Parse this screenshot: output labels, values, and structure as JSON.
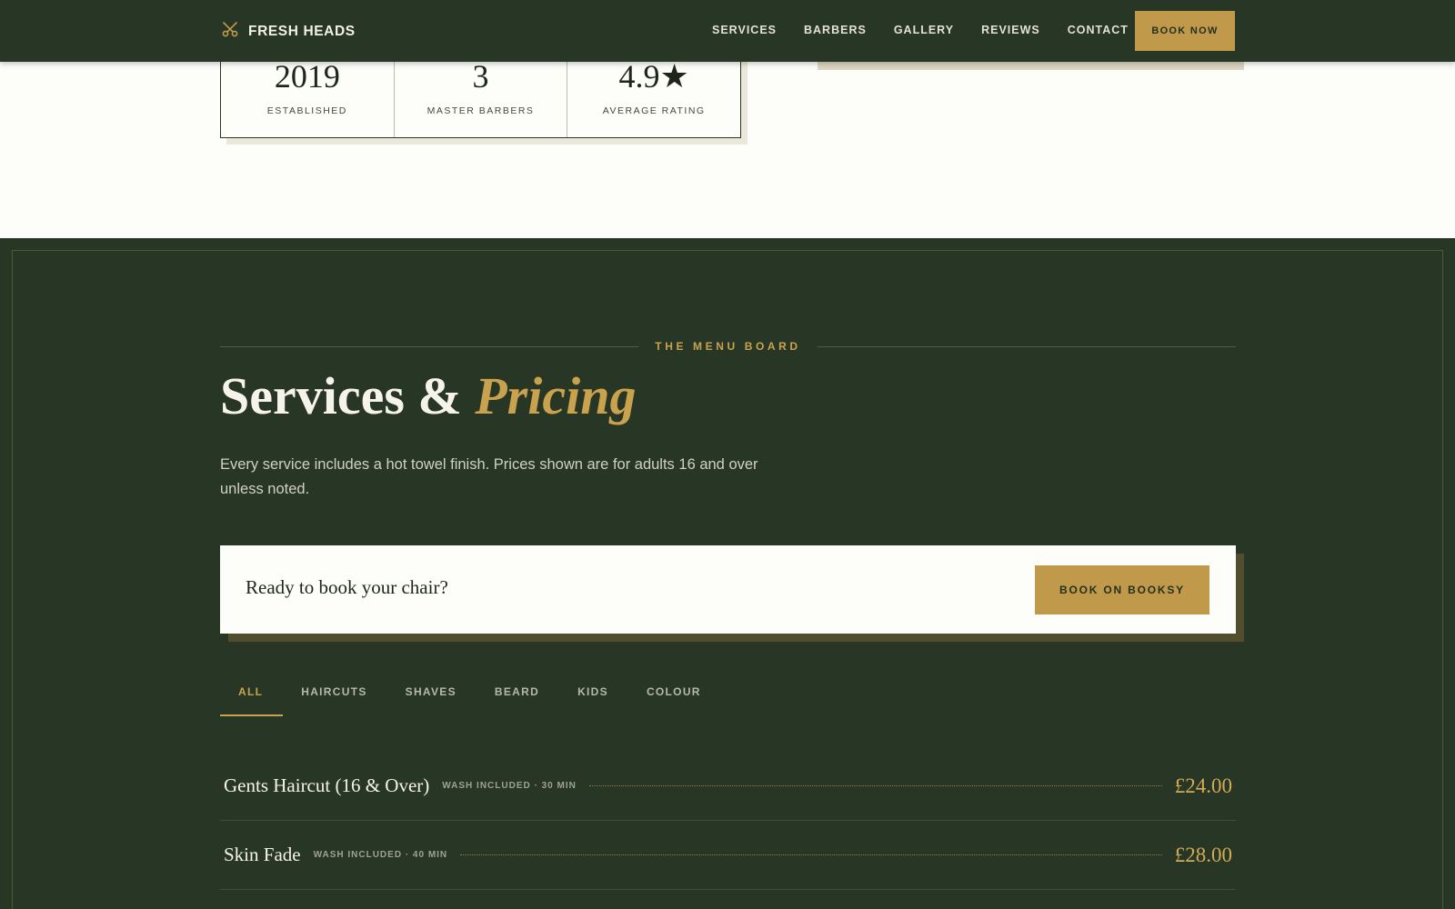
{
  "nav": {
    "brand": "FRESH HEADS",
    "links": [
      "SERVICES",
      "BARBERS",
      "GALLERY",
      "REVIEWS",
      "CONTACT"
    ],
    "book_label": "BOOK NOW"
  },
  "stats": [
    {
      "value": "2019",
      "label": "ESTABLISHED"
    },
    {
      "value": "3",
      "label": "MASTER BARBERS"
    },
    {
      "value": "4.9★",
      "label": "AVERAGE RATING"
    }
  ],
  "services": {
    "eyebrow": "THE MENU BOARD",
    "title_main": "Services & ",
    "title_accent": "Pricing",
    "intro": "Every service includes a hot towel finish. Prices shown are for adults 16 and over unless noted.",
    "cta_text": "Ready to book your chair?",
    "cta_button": "BOOK ON BOOKSY",
    "tabs": [
      "ALL",
      "HAIRCUTS",
      "SHAVES",
      "BEARD",
      "KIDS",
      "COLOUR"
    ],
    "items": [
      {
        "name": "Gents Haircut (16 & Over)",
        "meta": "WASH INCLUDED · 30 MIN",
        "price": "£24.00"
      },
      {
        "name": "Skin Fade",
        "meta": "WASH INCLUDED · 40 MIN",
        "price": "£28.00"
      }
    ]
  },
  "colors": {
    "dark_green": "#283625",
    "gold": "#c09a4a",
    "cream": "#fdfdf9"
  }
}
